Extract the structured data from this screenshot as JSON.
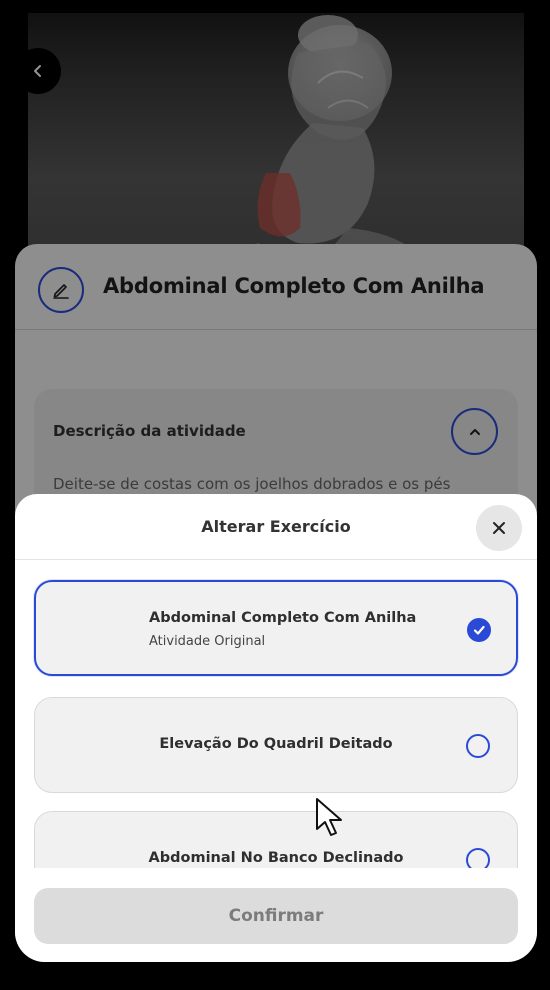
{
  "detail": {
    "title": "Abdominal Completo Com Anilha",
    "description_heading": "Descrição da atividade",
    "description_text": "Deite-se de costas com os joelhos dobrados e os pés"
  },
  "sheet": {
    "title": "Alterar Exercício",
    "options": [
      {
        "name": "Abdominal Completo Com Anilha",
        "subtitle": "Atividade Original",
        "selected": true
      },
      {
        "name": "Elevação Do Quadril Deitado",
        "selected": false
      },
      {
        "name": "Abdominal No Banco Declinado",
        "selected": false
      }
    ],
    "confirm_label": "Confirmar"
  },
  "icons": {
    "back": "chevron-left-icon",
    "edit": "pencil-icon",
    "toggle": "chevron-up-icon",
    "close": "close-icon",
    "check": "check-icon",
    "cursor": "mouse-pointer-icon"
  },
  "colors": {
    "accent": "#2a4ad6",
    "sheet_bg": "#ffffff",
    "confirm_disabled_bg": "#dcdcdc",
    "confirm_disabled_text": "#7c7c7c"
  }
}
